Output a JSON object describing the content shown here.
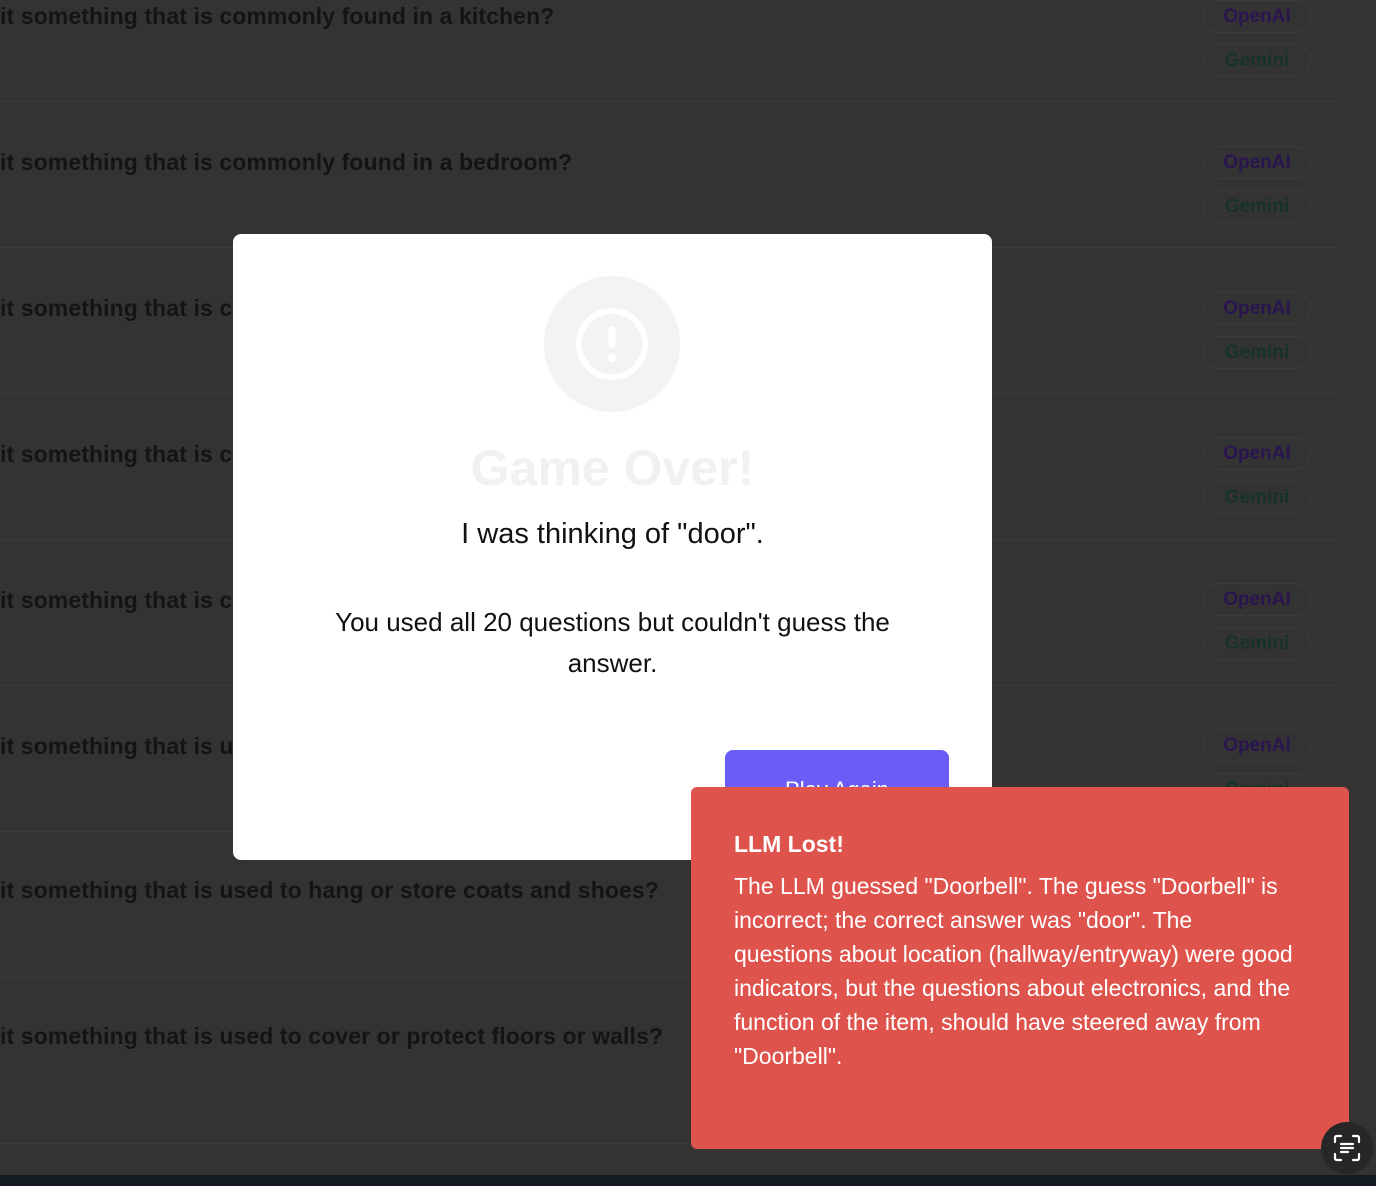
{
  "questions": [
    {
      "text": "it something that is commonly found in a kitchen?"
    },
    {
      "text": "it something that is commonly found in a bedroom?"
    },
    {
      "text": "it something that is c"
    },
    {
      "text": "it something that is c"
    },
    {
      "text": "it something that is c"
    },
    {
      "text": "it something that is u"
    },
    {
      "text": "it something that is used to hang or store coats and shoes?"
    },
    {
      "text": "it something that is used to cover or protect floors or walls?"
    }
  ],
  "badges": {
    "openai": "OpenAI",
    "gemini": "Gemini"
  },
  "modal": {
    "icon": "exclamation-circle-icon",
    "title": "Game Over!",
    "answer": "I was thinking of \"door\".",
    "message": "You used all 20 questions but couldn't guess the answer.",
    "play_again_label": "Play Again"
  },
  "toast": {
    "title": "LLM Lost!",
    "body": "The LLM guessed \"Doorbell\". The guess \"Doorbell\" is incorrect; the correct answer was \"door\". The questions about location (hallway/entryway) were good indicators, but the questions about electronics, and the function of the item, should have steered away from \"Doorbell\"."
  },
  "colors": {
    "accent": "#6a5cf4",
    "toast_bg": "#df534d",
    "backdrop": "#333333"
  },
  "floating_button": {
    "icon": "scan-text-icon"
  }
}
